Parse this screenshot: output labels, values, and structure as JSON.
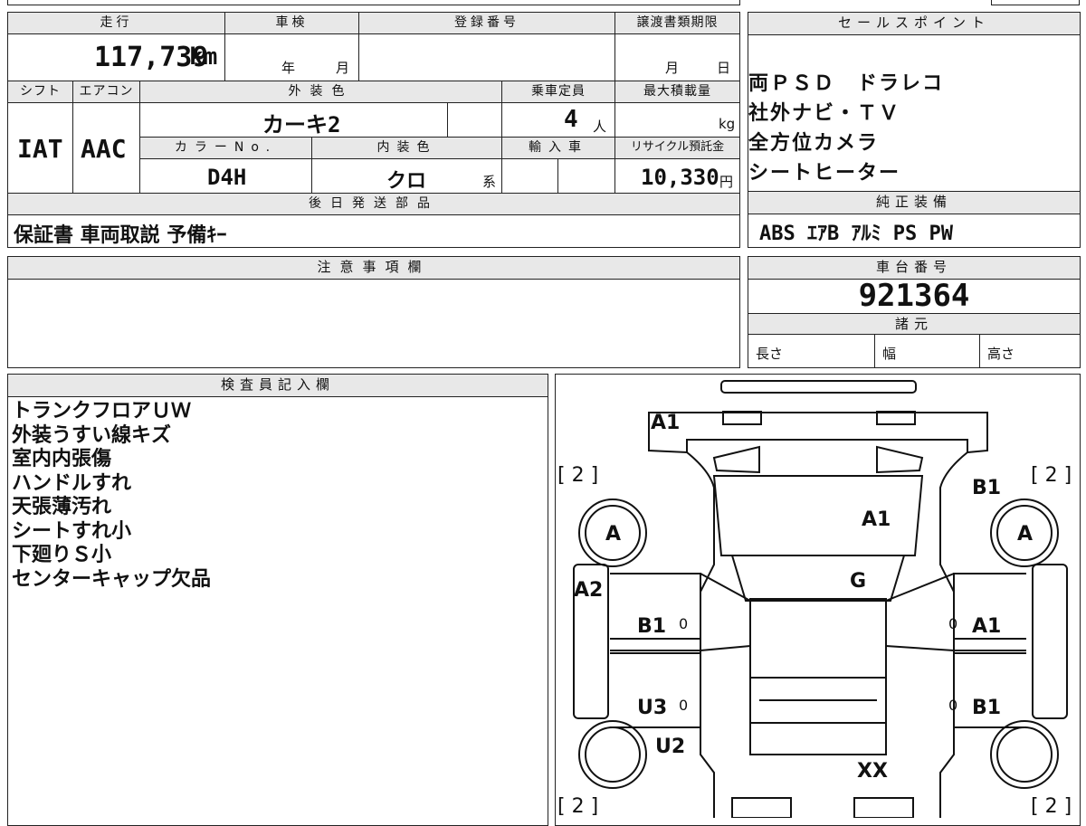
{
  "main_info": {
    "mileage_label": "走行",
    "mileage_value": "117,739",
    "mileage_unit": "km",
    "inspection_label": "車検",
    "inspection_year": "年",
    "inspection_month": "月",
    "registration_label": "登録番号",
    "transfer_label": "譲渡書類期限",
    "transfer_month": "月",
    "transfer_day": "日",
    "shift_label": "シフト",
    "shift_value": "IAT",
    "ac_label": "エアコン",
    "ac_value": "AAC",
    "exterior_label": "外装色",
    "exterior_value": "カーキ2",
    "capacity_label": "乗車定員",
    "capacity_value": "4",
    "capacity_unit": "人",
    "load_label": "最大積載量",
    "load_unit": "kg",
    "color_no_label": "カラーNo.",
    "color_no_value": "D4H",
    "interior_label": "内装色",
    "interior_value": "クロ",
    "interior_suffix": "系",
    "import_label": "輸入車",
    "recycle_label": "リサイクル預託金",
    "recycle_value": "10,330",
    "recycle_unit": "円",
    "later_label": "後日発送部品",
    "later_value": "保証書 車両取説 予備ｷｰ"
  },
  "sales_point": {
    "label": "セールスポイント",
    "lines": [
      "両ＰＳＤ　ドラレコ",
      "社外ナビ・ＴＶ",
      "全方位カメラ",
      "シートヒーター"
    ]
  },
  "equipment": {
    "label": "純正装備",
    "value": "ABS ｴｱB ｱﾙﾐ PS PW"
  },
  "notes": {
    "label": "注意事項欄"
  },
  "chassis": {
    "label": "車台番号",
    "value": "921364",
    "spec_label": "諸元",
    "length_label": "長さ",
    "width_label": "幅",
    "height_label": "高さ"
  },
  "inspector": {
    "label": "検査員記入欄",
    "lines": [
      "トランクフロアＵＷ",
      "外装うすい線キズ",
      "室内内張傷",
      "ハンドルすれ",
      "天張薄汚れ",
      "シートすれ小",
      "下廻りＳ小",
      "センターキャップ欠品"
    ]
  },
  "diagram": {
    "marks": {
      "front": "A1",
      "hood": "A1",
      "windshield": "G",
      "fender_left": "A2",
      "door_front_left": "B1",
      "door_rear_left": "U3",
      "quarter_left": "U2",
      "fender_right": "B1",
      "door_front_right": "A1",
      "door_rear_right": "B1",
      "roof_rear": "XX",
      "wheel_front_left": "A",
      "wheel_front_right": "A"
    },
    "tire_tl": "[ 2 ]",
    "tire_tr": "[ 2 ]",
    "tire_bl": "[ 2 ]",
    "tire_br": "[ 2 ]",
    "zero": "0"
  }
}
